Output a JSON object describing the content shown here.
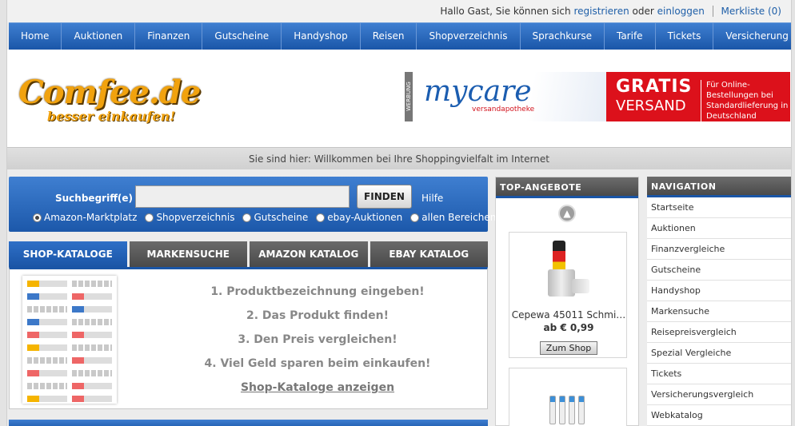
{
  "userbar": {
    "greeting": "Hallo Gast, Sie können sich",
    "register": "registrieren",
    "or": "oder",
    "login": "einloggen",
    "wishlist": "Merkliste (0)"
  },
  "mainnav": [
    "Home",
    "Auktionen",
    "Finanzen",
    "Gutscheine",
    "Handyshop",
    "Reisen",
    "Shopverzeichnis",
    "Sprachkurse",
    "Tarife",
    "Tickets",
    "Versicherung"
  ],
  "logo": {
    "title": "Comfee.de",
    "slogan": "besser einkaufen!"
  },
  "banner": {
    "tag": "WERBUNG",
    "brand": "mycare",
    "brand_sub": "versandapotheke",
    "gratis": "GRATIS",
    "versand": "VERSAND",
    "note": "Für Online-Bestellungen bei Standardlieferung in Deutschland"
  },
  "breadcrumb": "Sie sind hier: Willkommen bei Ihre Shoppingvielfalt im Internet",
  "search": {
    "label": "Suchbegriff(e)",
    "value": "",
    "button": "FINDEN",
    "help": "Hilfe",
    "options": [
      {
        "label": "Amazon-Marktplatz",
        "selected": true
      },
      {
        "label": "Shopverzeichnis",
        "selected": false
      },
      {
        "label": "Gutscheine",
        "selected": false
      },
      {
        "label": "ebay-Auktionen",
        "selected": false
      },
      {
        "label": "allen Bereichen",
        "selected": false
      }
    ]
  },
  "tabs": [
    "SHOP-KATALOGE",
    "MARKENSUCHE",
    "AMAZON KATALOG",
    "EBAY KATALOG"
  ],
  "catalog": {
    "steps": [
      "1. Produktbezeichnung eingeben!",
      "2. Das Produkt finden!",
      "3. Den Preis vergleichen!",
      "4. Viel Geld sparen beim einkaufen!"
    ],
    "link": "Shop-Kataloge anzeigen"
  },
  "top_offers": {
    "title": "TOP-ANGEBOTE",
    "product": "Cepewa 45011 Schmi…",
    "price": "ab € 0,99",
    "button": "Zum Shop"
  },
  "navigation": {
    "title": "NAVIGATION",
    "items": [
      "Startseite",
      "Auktionen",
      "Finanzvergleiche",
      "Gutscheine",
      "Handyshop",
      "Markensuche",
      "Reisepreisvergleich",
      "Spezial Vergleiche",
      "Tickets",
      "Versicherungsvergleich",
      "Webkatalog"
    ]
  },
  "colors": {
    "nav_blue": "#1a56a8",
    "tab_gray": "#4a4a4a",
    "logo_orange": "#f1a20e",
    "banner_red": "#dc111b"
  }
}
